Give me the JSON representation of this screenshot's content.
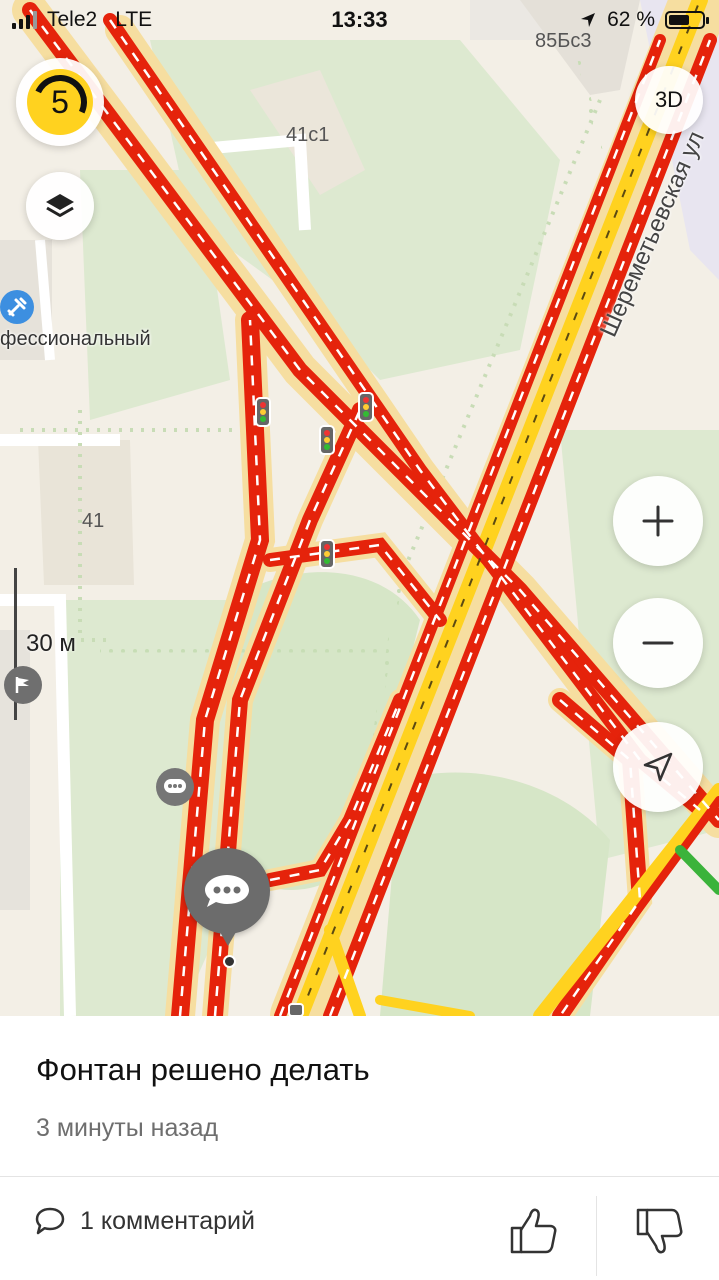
{
  "status_bar": {
    "carrier": "Tele2",
    "network": "LTE",
    "time": "13:33",
    "battery": "62 %",
    "battery_level": 0.62
  },
  "map": {
    "traffic_level": "5",
    "btn_3d": "3D",
    "scale": "30 м",
    "street": "Шереметьевская ул",
    "building_labels": [
      "85Бс3",
      "41с1",
      "41"
    ],
    "poi_label": "фессиональный",
    "colors": {
      "jam": "#e5230b",
      "slow": "#ffd21f",
      "free": "#3bb33b",
      "road": "#f8dfa3",
      "park": "#dce9cf"
    }
  },
  "card": {
    "title": "Фонтан решено делать",
    "time_ago": "3 минуты назад",
    "comments": "1 комментарий"
  },
  "icons": [
    "layers-icon",
    "plus-icon",
    "minus-icon",
    "location-arrow-icon",
    "comment-icon",
    "thumbs-up-icon",
    "thumbs-down-icon",
    "wrench-icon",
    "flag-icon",
    "chat-bubble-icon"
  ]
}
